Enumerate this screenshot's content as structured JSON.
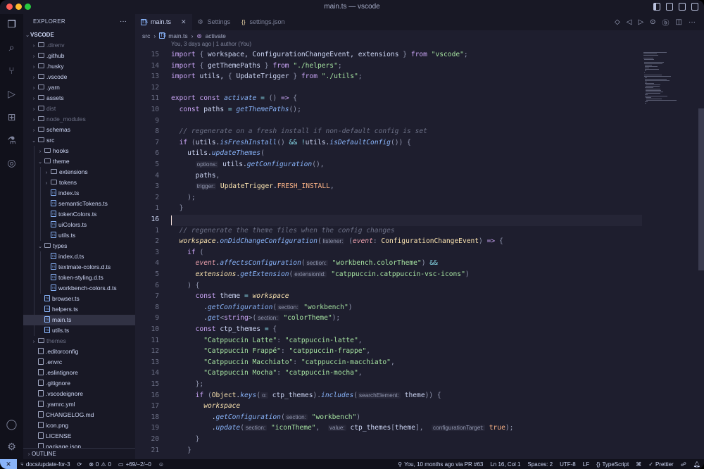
{
  "window": {
    "title": "main.ts — vscode"
  },
  "colors": {
    "accent": "#89b4fa",
    "background": "#1e1e2e",
    "sidebar": "#181825",
    "close": "#ff5f57",
    "minimize": "#febc2e",
    "maximize": "#28c840"
  },
  "activity_bar": [
    "files-icon",
    "search-icon",
    "source-control-icon",
    "run-debug-icon",
    "extensions-icon",
    "testing-icon",
    "git-graph-icon",
    "account-icon",
    "settings-gear-icon"
  ],
  "sidebar": {
    "header": "EXPLORER",
    "root": "VSCODE",
    "items": [
      {
        "label": ".direnv",
        "type": "folder",
        "depth": 1,
        "dim": true
      },
      {
        "label": ".github",
        "type": "folder",
        "depth": 1
      },
      {
        "label": ".husky",
        "type": "folder",
        "depth": 1
      },
      {
        "label": ".vscode",
        "type": "folder",
        "depth": 1
      },
      {
        "label": ".yarn",
        "type": "folder",
        "depth": 1
      },
      {
        "label": "assets",
        "type": "folder",
        "depth": 1
      },
      {
        "label": "dist",
        "type": "folder",
        "depth": 1,
        "dim": true
      },
      {
        "label": "node_modules",
        "type": "folder",
        "depth": 1,
        "dim": true
      },
      {
        "label": "schemas",
        "type": "folder",
        "depth": 1
      },
      {
        "label": "src",
        "type": "folder",
        "depth": 1,
        "open": true
      },
      {
        "label": "hooks",
        "type": "folder",
        "depth": 2
      },
      {
        "label": "theme",
        "type": "folder",
        "depth": 2,
        "open": true
      },
      {
        "label": "extensions",
        "type": "folder",
        "depth": 3
      },
      {
        "label": "tokens",
        "type": "folder",
        "depth": 3
      },
      {
        "label": "index.ts",
        "type": "ts",
        "depth": 3
      },
      {
        "label": "semanticTokens.ts",
        "type": "ts",
        "depth": 3
      },
      {
        "label": "tokenColors.ts",
        "type": "ts",
        "depth": 3
      },
      {
        "label": "uiColors.ts",
        "type": "ts",
        "depth": 3
      },
      {
        "label": "utils.ts",
        "type": "ts",
        "depth": 3
      },
      {
        "label": "types",
        "type": "folder",
        "depth": 2,
        "open": true
      },
      {
        "label": "index.d.ts",
        "type": "ts",
        "depth": 3
      },
      {
        "label": "textmate-colors.d.ts",
        "type": "ts",
        "depth": 3
      },
      {
        "label": "token-styling.d.ts",
        "type": "ts",
        "depth": 3
      },
      {
        "label": "workbench-colors.d.ts",
        "type": "ts",
        "depth": 3
      },
      {
        "label": "browser.ts",
        "type": "ts",
        "depth": 2
      },
      {
        "label": "helpers.ts",
        "type": "ts",
        "depth": 2
      },
      {
        "label": "main.ts",
        "type": "ts",
        "depth": 2,
        "selected": true
      },
      {
        "label": "utils.ts",
        "type": "ts",
        "depth": 2
      },
      {
        "label": "themes",
        "type": "folder",
        "depth": 1,
        "dim": true
      },
      {
        "label": ".editorconfig",
        "type": "file",
        "depth": 1
      },
      {
        "label": ".envrc",
        "type": "file",
        "depth": 1
      },
      {
        "label": ".eslintignore",
        "type": "file",
        "depth": 1
      },
      {
        "label": ".gitignore",
        "type": "file",
        "depth": 1
      },
      {
        "label": ".vscodeignore",
        "type": "file",
        "depth": 1
      },
      {
        "label": ".yarnrc.yml",
        "type": "file",
        "depth": 1
      },
      {
        "label": "CHANGELOG.md",
        "type": "file",
        "depth": 1
      },
      {
        "label": "icon.png",
        "type": "file",
        "depth": 1
      },
      {
        "label": "LICENSE",
        "type": "file",
        "depth": 1
      },
      {
        "label": "package.json",
        "type": "file",
        "depth": 1
      }
    ],
    "outline": "OUTLINE"
  },
  "tabs": [
    {
      "label": "main.ts",
      "active": true,
      "icon": "ts-icon"
    },
    {
      "label": "Settings",
      "active": false,
      "icon": "gear-icon"
    },
    {
      "label": "settings.json",
      "active": false,
      "icon": "braces-icon"
    }
  ],
  "breadcrumb": {
    "folder": "src",
    "file": "main.ts",
    "symbol": "activate"
  },
  "codelens": "You, 3 days ago | 1 author (You)",
  "code_lines": [
    {
      "n": "15",
      "tokens": [
        [
          "k",
          "import "
        ],
        [
          "p",
          "{ "
        ],
        [
          "",
          "workspace, ConfigurationChangeEvent, extensions "
        ],
        [
          "p",
          "} "
        ],
        [
          "k",
          "from "
        ],
        [
          "s",
          "\"vscode\""
        ],
        [
          "p",
          ";"
        ]
      ]
    },
    {
      "n": "14",
      "tokens": [
        [
          "k",
          "import "
        ],
        [
          "p",
          "{ "
        ],
        [
          "",
          "getThemePaths "
        ],
        [
          "p",
          "} "
        ],
        [
          "k",
          "from "
        ],
        [
          "s",
          "\"./helpers\""
        ],
        [
          "p",
          ";"
        ]
      ]
    },
    {
      "n": "13",
      "tokens": [
        [
          "k",
          "import "
        ],
        [
          "",
          "utils, "
        ],
        [
          "p",
          "{ "
        ],
        [
          "",
          "UpdateTrigger "
        ],
        [
          "p",
          "} "
        ],
        [
          "k",
          "from "
        ],
        [
          "s",
          "\"./utils\""
        ],
        [
          "p",
          ";"
        ]
      ]
    },
    {
      "n": "12",
      "tokens": []
    },
    {
      "n": "11",
      "tokens": [
        [
          "k",
          "export const "
        ],
        [
          "f",
          "activate"
        ],
        [
          "o",
          " = "
        ],
        [
          "p",
          "() "
        ],
        [
          "k",
          "=> "
        ],
        [
          "p",
          "{"
        ]
      ]
    },
    {
      "n": "10",
      "tokens": [
        [
          "",
          "  "
        ],
        [
          "k",
          "const "
        ],
        [
          "",
          "paths "
        ],
        [
          "o",
          "= "
        ],
        [
          "f",
          "getThemePaths"
        ],
        [
          "p",
          "();"
        ]
      ]
    },
    {
      "n": "9",
      "tokens": []
    },
    {
      "n": "8",
      "tokens": [
        [
          "",
          "  "
        ],
        [
          "c",
          "// regenerate on a fresh install if non-default config is set"
        ]
      ]
    },
    {
      "n": "7",
      "tokens": [
        [
          "",
          "  "
        ],
        [
          "k",
          "if "
        ],
        [
          "p",
          "("
        ],
        [
          "",
          "utils."
        ],
        [
          "f",
          "isFreshInstall"
        ],
        [
          "p",
          "() "
        ],
        [
          "o",
          "&& !"
        ],
        [
          "",
          "utils."
        ],
        [
          "f",
          "isDefaultConfig"
        ],
        [
          "p",
          "()) {"
        ]
      ]
    },
    {
      "n": "6",
      "tokens": [
        [
          "",
          "    utils."
        ],
        [
          "f",
          "updateThemes"
        ],
        [
          "p",
          "("
        ]
      ]
    },
    {
      "n": "5",
      "tokens": [
        [
          "",
          "      "
        ],
        [
          "ih",
          "options:"
        ],
        [
          "",
          " utils."
        ],
        [
          "f",
          "getConfiguration"
        ],
        [
          "p",
          "(),"
        ]
      ]
    },
    {
      "n": "4",
      "tokens": [
        [
          "",
          "      paths"
        ],
        [
          "p",
          ","
        ]
      ]
    },
    {
      "n": "3",
      "tokens": [
        [
          "",
          "      "
        ],
        [
          "ih",
          "trigger:"
        ],
        [
          "",
          " "
        ],
        [
          "t",
          "UpdateTrigger"
        ],
        [
          "",
          "."
        ],
        [
          "n",
          "FRESH_INSTALL"
        ],
        [
          "p",
          ","
        ]
      ]
    },
    {
      "n": "2",
      "tokens": [
        [
          "",
          "    "
        ],
        [
          "p",
          ");"
        ]
      ]
    },
    {
      "n": "1",
      "tokens": [
        [
          "",
          "  "
        ],
        [
          "p",
          "}"
        ]
      ]
    },
    {
      "n": "16",
      "tokens": [],
      "current": true
    },
    {
      "n": "1",
      "tokens": [
        [
          "",
          "  "
        ],
        [
          "c",
          "// regenerate the theme files when the config changes"
        ]
      ]
    },
    {
      "n": "2",
      "tokens": [
        [
          "",
          "  "
        ],
        [
          "v",
          "workspace"
        ],
        [
          "",
          "."
        ],
        [
          "f",
          "onDidChangeConfiguration"
        ],
        [
          "p",
          "("
        ],
        [
          "ih",
          "listener:"
        ],
        [
          "",
          " "
        ],
        [
          "p",
          "("
        ],
        [
          "pm",
          "event"
        ],
        [
          "p",
          ": "
        ],
        [
          "t",
          "ConfigurationChangeEvent"
        ],
        [
          "p",
          ") "
        ],
        [
          "k",
          "=> "
        ],
        [
          "p",
          "{"
        ]
      ]
    },
    {
      "n": "3",
      "tokens": [
        [
          "",
          "    "
        ],
        [
          "k",
          "if "
        ],
        [
          "p",
          "("
        ]
      ]
    },
    {
      "n": "4",
      "tokens": [
        [
          "",
          "      "
        ],
        [
          "pm",
          "event"
        ],
        [
          "",
          "."
        ],
        [
          "f",
          "affectsConfiguration"
        ],
        [
          "p",
          "("
        ],
        [
          "ih",
          "section:"
        ],
        [
          "",
          " "
        ],
        [
          "s",
          "\"workbench.colorTheme\""
        ],
        [
          "p",
          ") "
        ],
        [
          "o",
          "&&"
        ]
      ]
    },
    {
      "n": "5",
      "tokens": [
        [
          "",
          "      "
        ],
        [
          "v",
          "extensions"
        ],
        [
          "",
          "."
        ],
        [
          "f",
          "getExtension"
        ],
        [
          "p",
          "("
        ],
        [
          "ih",
          "extensionId:"
        ],
        [
          "",
          " "
        ],
        [
          "s",
          "\"catppuccin.catppuccin-vsc-icons\""
        ],
        [
          "p",
          ")"
        ]
      ]
    },
    {
      "n": "6",
      "tokens": [
        [
          "",
          "    "
        ],
        [
          "p",
          ") {"
        ]
      ]
    },
    {
      "n": "7",
      "tokens": [
        [
          "",
          "      "
        ],
        [
          "k",
          "const "
        ],
        [
          "",
          "theme "
        ],
        [
          "o",
          "= "
        ],
        [
          "v",
          "workspace"
        ]
      ]
    },
    {
      "n": "8",
      "tokens": [
        [
          "",
          "        ."
        ],
        [
          "f",
          "getConfiguration"
        ],
        [
          "p",
          "("
        ],
        [
          "ih",
          "section:"
        ],
        [
          "",
          " "
        ],
        [
          "s",
          "\"workbench\""
        ],
        [
          "p",
          ")"
        ]
      ]
    },
    {
      "n": "9",
      "tokens": [
        [
          "",
          "        ."
        ],
        [
          "f",
          "get"
        ],
        [
          "p",
          "<"
        ],
        [
          "k",
          "string"
        ],
        [
          "p",
          ">("
        ],
        [
          "ih",
          "section:"
        ],
        [
          "",
          " "
        ],
        [
          "s",
          "\"colorTheme\""
        ],
        [
          "p",
          ");"
        ]
      ]
    },
    {
      "n": "10",
      "tokens": [
        [
          "",
          "      "
        ],
        [
          "k",
          "const "
        ],
        [
          "",
          "ctp_themes "
        ],
        [
          "o",
          "= "
        ],
        [
          "p",
          "{"
        ]
      ]
    },
    {
      "n": "11",
      "tokens": [
        [
          "",
          "        "
        ],
        [
          "s",
          "\"Catppuccin Latte\""
        ],
        [
          "p",
          ": "
        ],
        [
          "s",
          "\"catppuccin-latte\""
        ],
        [
          "p",
          ","
        ]
      ]
    },
    {
      "n": "12",
      "tokens": [
        [
          "",
          "        "
        ],
        [
          "s",
          "\"Catppuccin Frappé\""
        ],
        [
          "p",
          ": "
        ],
        [
          "s",
          "\"catppuccin-frappe\""
        ],
        [
          "p",
          ","
        ]
      ]
    },
    {
      "n": "13",
      "tokens": [
        [
          "",
          "        "
        ],
        [
          "s",
          "\"Catppuccin Macchiato\""
        ],
        [
          "p",
          ": "
        ],
        [
          "s",
          "\"catppuccin-macchiato\""
        ],
        [
          "p",
          ","
        ]
      ]
    },
    {
      "n": "14",
      "tokens": [
        [
          "",
          "        "
        ],
        [
          "s",
          "\"Catppuccin Mocha\""
        ],
        [
          "p",
          ": "
        ],
        [
          "s",
          "\"catppuccin-mocha\""
        ],
        [
          "p",
          ","
        ]
      ]
    },
    {
      "n": "15",
      "tokens": [
        [
          "",
          "      "
        ],
        [
          "p",
          "};"
        ]
      ]
    },
    {
      "n": "16",
      "tokens": [
        [
          "",
          "      "
        ],
        [
          "k",
          "if "
        ],
        [
          "p",
          "("
        ],
        [
          "t",
          "Object"
        ],
        [
          "",
          "."
        ],
        [
          "f",
          "keys"
        ],
        [
          "p",
          "("
        ],
        [
          "ih",
          "o:"
        ],
        [
          "",
          " ctp_themes"
        ],
        [
          "p",
          ")."
        ],
        [
          "f",
          "includes"
        ],
        [
          "p",
          "("
        ],
        [
          "ih",
          "searchElement:"
        ],
        [
          "",
          " theme"
        ],
        [
          "p",
          ")) {"
        ]
      ]
    },
    {
      "n": "17",
      "tokens": [
        [
          "",
          "        "
        ],
        [
          "v",
          "workspace"
        ]
      ]
    },
    {
      "n": "18",
      "tokens": [
        [
          "",
          "          ."
        ],
        [
          "f",
          "getConfiguration"
        ],
        [
          "p",
          "("
        ],
        [
          "ih",
          "section:"
        ],
        [
          "",
          " "
        ],
        [
          "s",
          "\"workbench\""
        ],
        [
          "p",
          ")"
        ]
      ]
    },
    {
      "n": "19",
      "tokens": [
        [
          "",
          "          ."
        ],
        [
          "f",
          "update"
        ],
        [
          "p",
          "("
        ],
        [
          "ih",
          "section:"
        ],
        [
          "",
          " "
        ],
        [
          "s",
          "\"iconTheme\""
        ],
        [
          "p",
          ",  "
        ],
        [
          "ih",
          "value:"
        ],
        [
          "",
          " ctp_themes"
        ],
        [
          "p",
          "["
        ],
        [
          "",
          "theme"
        ],
        [
          "p",
          "],  "
        ],
        [
          "ih",
          "configurationTarget:"
        ],
        [
          "",
          " "
        ],
        [
          "n",
          "true"
        ],
        [
          "p",
          ");"
        ]
      ]
    },
    {
      "n": "20",
      "tokens": [
        [
          "",
          "      "
        ],
        [
          "p",
          "}"
        ]
      ]
    },
    {
      "n": "21",
      "tokens": [
        [
          "",
          "    "
        ],
        [
          "p",
          "}"
        ]
      ]
    }
  ],
  "status": {
    "remote_icon": "remote-icon",
    "branch": "docs/update-for-3",
    "errors": "0",
    "warnings": "0",
    "changes": "+69/−2/−0",
    "blame": "You, 10 months ago via PR #63",
    "position": "Ln 16, Col 1",
    "spaces": "Spaces: 2",
    "encoding": "UTF-8",
    "eol": "LF",
    "language": "TypeScript",
    "formatter": "Prettier"
  }
}
